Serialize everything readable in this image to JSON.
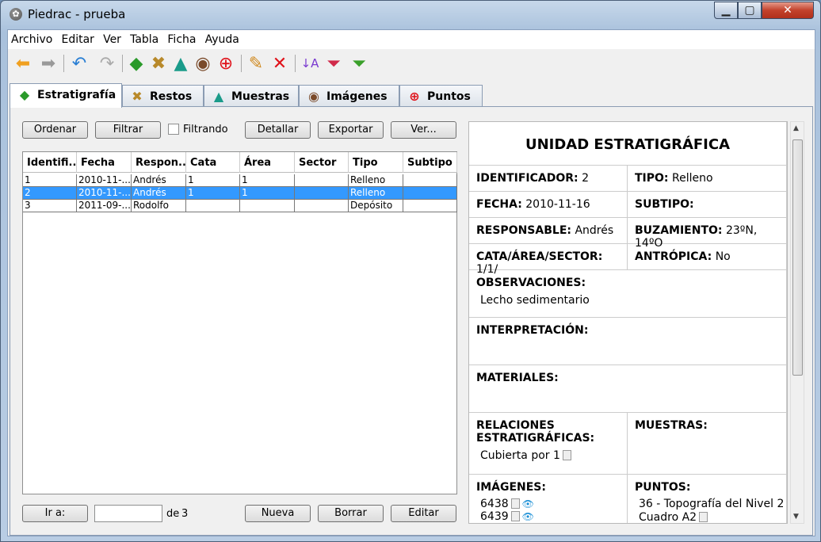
{
  "window": {
    "title": "Piedrac - prueba",
    "min": "▁",
    "max": "▢",
    "close": "✕"
  },
  "menu": [
    "Archivo",
    "Editar",
    "Ver",
    "Tabla",
    "Ficha",
    "Ayuda"
  ],
  "tabs": [
    {
      "label": "Estratigrafía",
      "icon": "green-diamond-icon"
    },
    {
      "label": "Restos",
      "icon": "bones-icon"
    },
    {
      "label": "Muestras",
      "icon": "flask-icon"
    },
    {
      "label": "Imágenes",
      "icon": "eye-icon"
    },
    {
      "label": "Puntos",
      "icon": "target-icon"
    }
  ],
  "list": {
    "buttons": {
      "ordenar": "Ordenar",
      "filtrar": "Filtrar",
      "detallar": "Detallar",
      "exportar": "Exportar",
      "ver": "Ver..."
    },
    "filtering_label": "Filtrando",
    "columns": [
      "Identifi...",
      "Fecha",
      "Respon...",
      "Cata",
      "Área",
      "Sector",
      "Tipo",
      "Subtipo"
    ],
    "rows": [
      [
        "1",
        "2010-11-...",
        "Andrés",
        "1",
        "1",
        "",
        "Relleno",
        ""
      ],
      [
        "2",
        "2010-11-...",
        "Andrés",
        "1",
        "1",
        "",
        "Relleno",
        ""
      ],
      [
        "3",
        "2011-09-...",
        "Rodolfo",
        "",
        "",
        "",
        "Depósito",
        ""
      ]
    ],
    "selected_row": 1,
    "goto_label": "Ir a:",
    "goto_value": "",
    "of_label": "de",
    "total": "3",
    "new_label": "Nueva",
    "delete_label": "Borrar",
    "edit_label": "Editar"
  },
  "detail": {
    "title": "UNIDAD ESTRATIGRÁFICA",
    "id_label": "IDENTIFICADOR:",
    "id_value": "2",
    "type_label": "TIPO:",
    "type_value": "Relleno",
    "date_label": "FECHA:",
    "date_value": "2010-11-16",
    "subtype_label": "SUBTIPO:",
    "subtype_value": "",
    "resp_label": "RESPONSABLE:",
    "resp_value": "Andrés",
    "dip_label": "BUZAMIENTO:",
    "dip_value": "23ºN, 14ºO",
    "cas_label": "CATA/ÁREA/SECTOR:",
    "cas_value": "1/1/",
    "anthro_label": "ANTRÓPICA:",
    "anthro_value": "No",
    "obs_label": "OBSERVACIONES:",
    "obs_value": "Lecho sedimentario",
    "interp_label": "INTERPRETACIÓN:",
    "materials_label": "MATERIALES:",
    "relations_label": "RELACIONES ESTRATIGRÁFICAS:",
    "relations_value": "Cubierta por 1",
    "samples_label": "MUESTRAS:",
    "images_label": "IMÁGENES:",
    "images": [
      "6438",
      "6439"
    ],
    "points_label": "PUNTOS:",
    "points_value": "36 - Topografía del Nivel 2 Cuadro A2"
  }
}
